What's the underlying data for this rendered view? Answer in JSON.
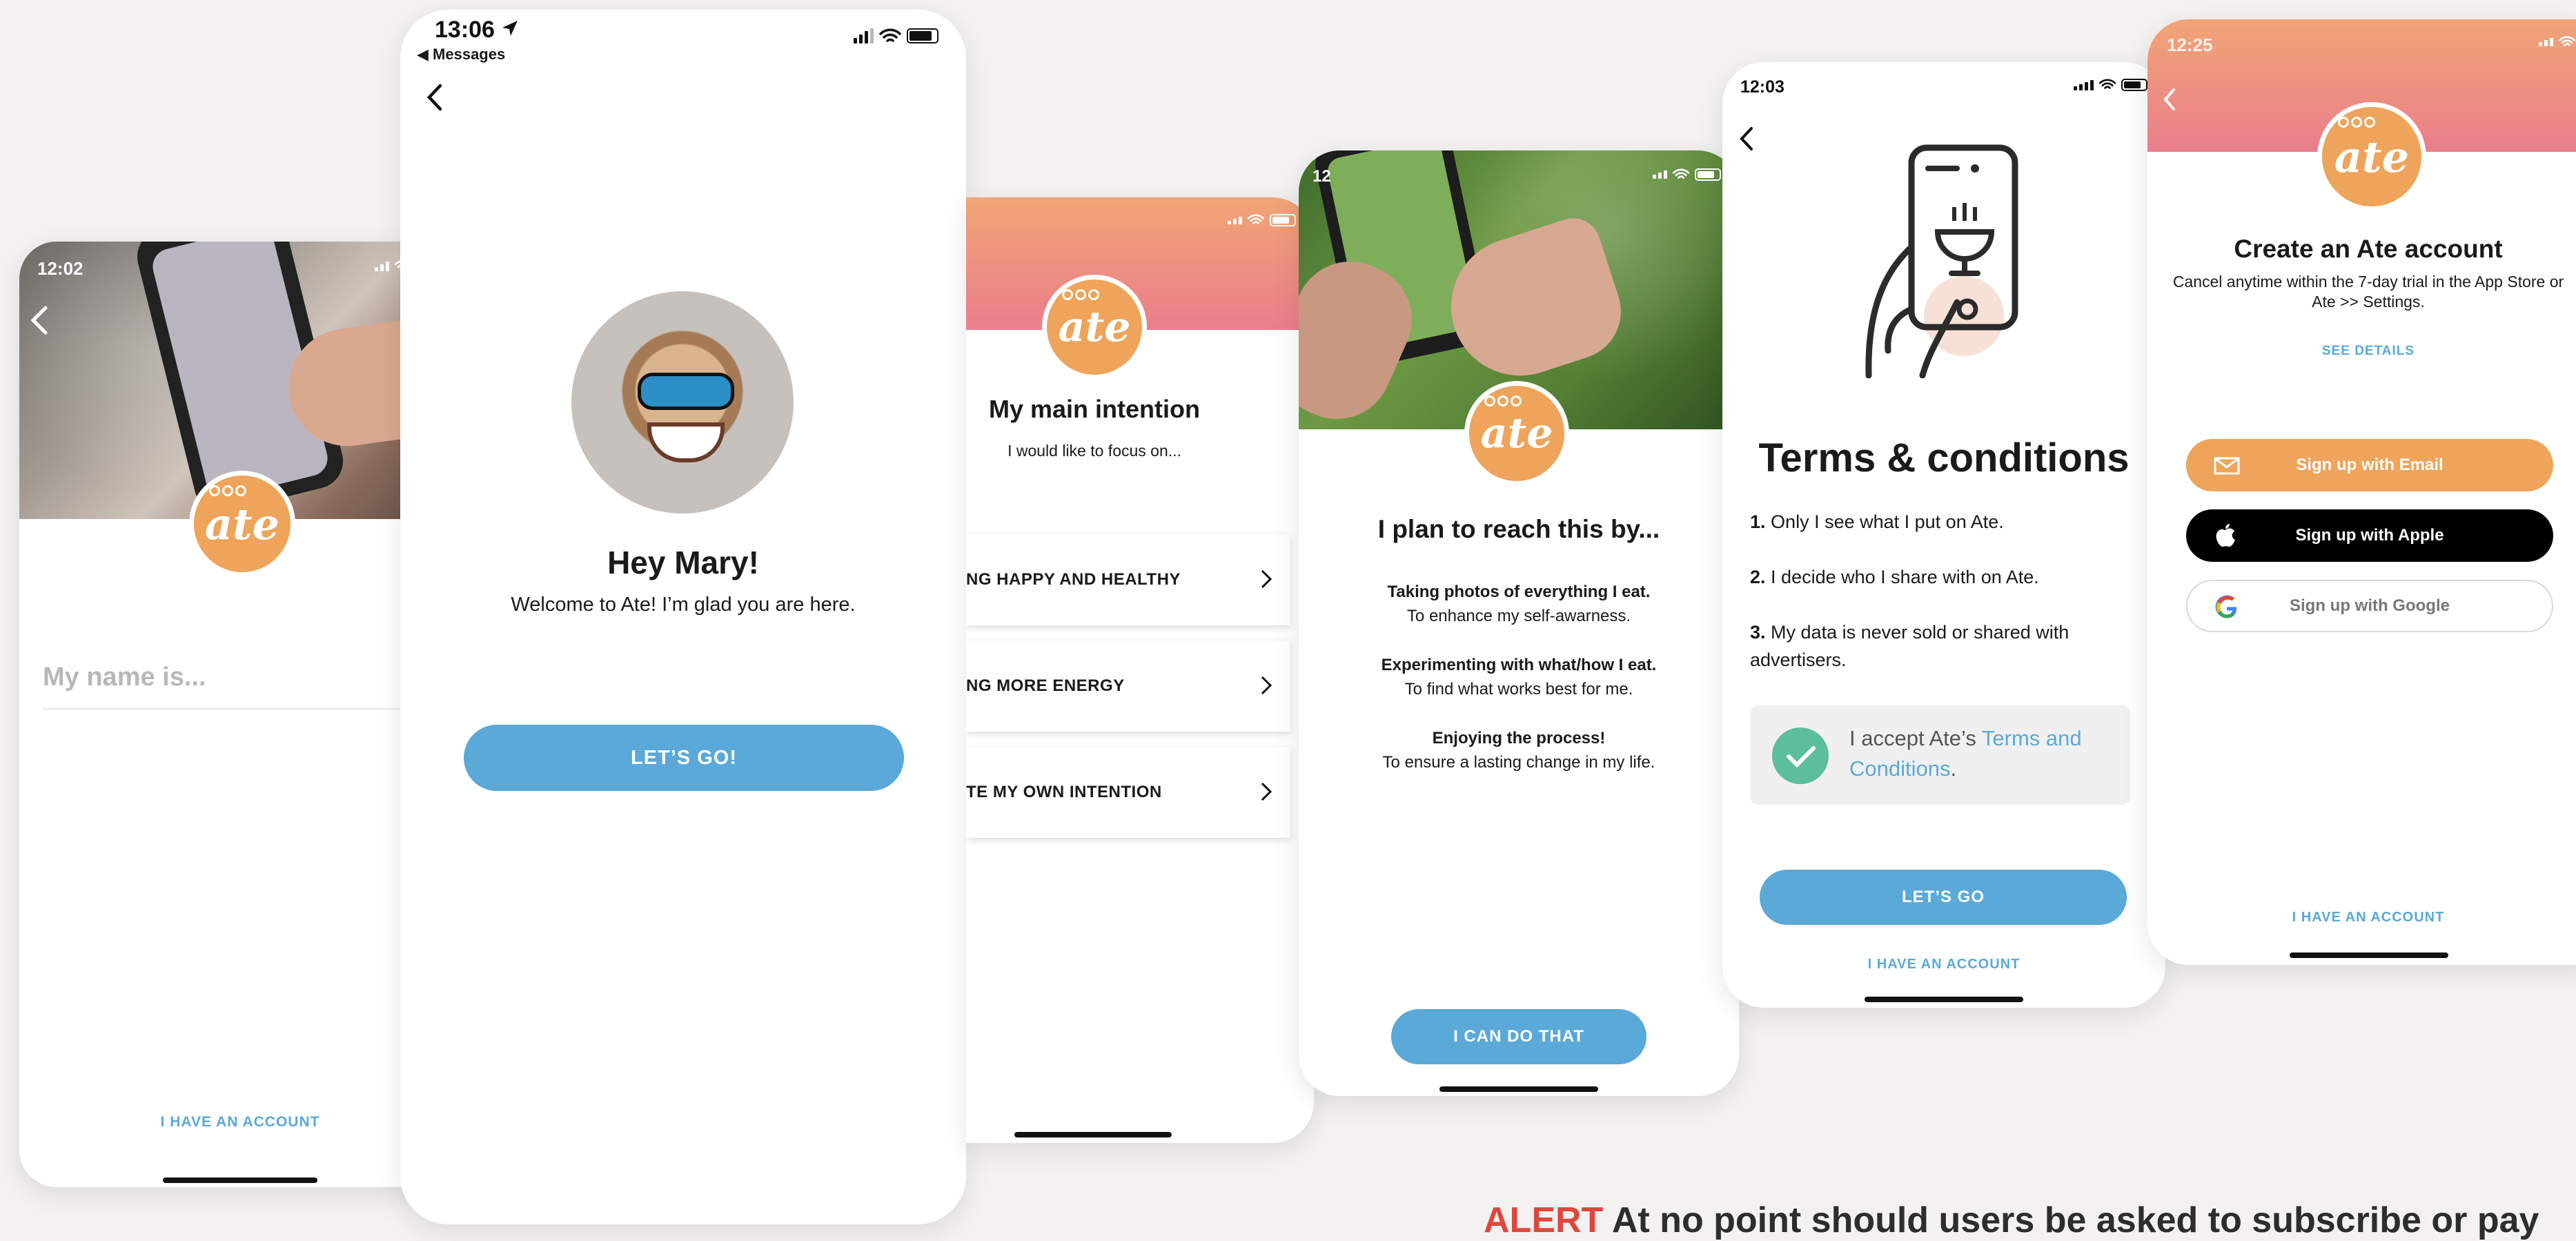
{
  "screens": {
    "name_entry": {
      "time": "12:02",
      "name_placeholder": "My name is...",
      "have_account": "I HAVE AN ACCOUNT"
    },
    "welcome": {
      "time": "13:06",
      "back_to_app": "◀ Messages",
      "greeting": "Hey Mary!",
      "message": "Welcome to Ate! I’m glad you are here.",
      "cta": "LET’S GO!"
    },
    "intention": {
      "title": "My main intention",
      "subtitle": "I would like to focus on...",
      "options": [
        {
          "label": "NG HAPPY AND HEALTHY"
        },
        {
          "label": "NG MORE ENERGY"
        },
        {
          "label": "TE MY OWN INTENTION"
        }
      ]
    },
    "plan": {
      "time": "12",
      "title": "I plan to reach this by...",
      "items": [
        {
          "bold": "Taking photos of everything I eat.",
          "sub": "To enhance my self-awarness."
        },
        {
          "bold": "Experimenting with what/how I eat.",
          "sub": "To find what works best for me."
        },
        {
          "bold": "Enjoying the process!",
          "sub": "To ensure a lasting change in my life."
        }
      ],
      "cta": "I CAN DO THAT"
    },
    "terms": {
      "time": "12:03",
      "title": "Terms & conditions",
      "items": [
        {
          "num": "1.",
          "text": "Only I see what I put on Ate."
        },
        {
          "num": "2.",
          "text": "I decide who I share with on Ate."
        },
        {
          "num": "3.",
          "text": "My data is never sold or shared with advertisers."
        }
      ],
      "accept_prefix": "I accept Ate’s",
      "accept_link": "Terms and Conditions",
      "accept_suffix": ".",
      "cta": "LET’S GO",
      "have_account": "I HAVE AN ACCOUNT"
    },
    "signup": {
      "time": "12:25",
      "title": "Create an Ate account",
      "subtitle": "Cancel anytime within the 7-day trial in the App Store or Ate >> Settings.",
      "details": "SEE DETAILS",
      "email": "Sign up with Email",
      "apple": "Sign up with Apple",
      "google": "Sign up with Google",
      "have_account": "I HAVE AN ACCOUNT"
    }
  },
  "logo_text": "ate",
  "alert": {
    "label": "ALERT",
    "text": "At no point should users be asked to subscribe or pay"
  },
  "colors": {
    "accent_blue": "#5aa9d8",
    "brand_orange": "#eea45a",
    "header_pink": "#ea7e8c",
    "check_green": "#5cbf9a"
  }
}
